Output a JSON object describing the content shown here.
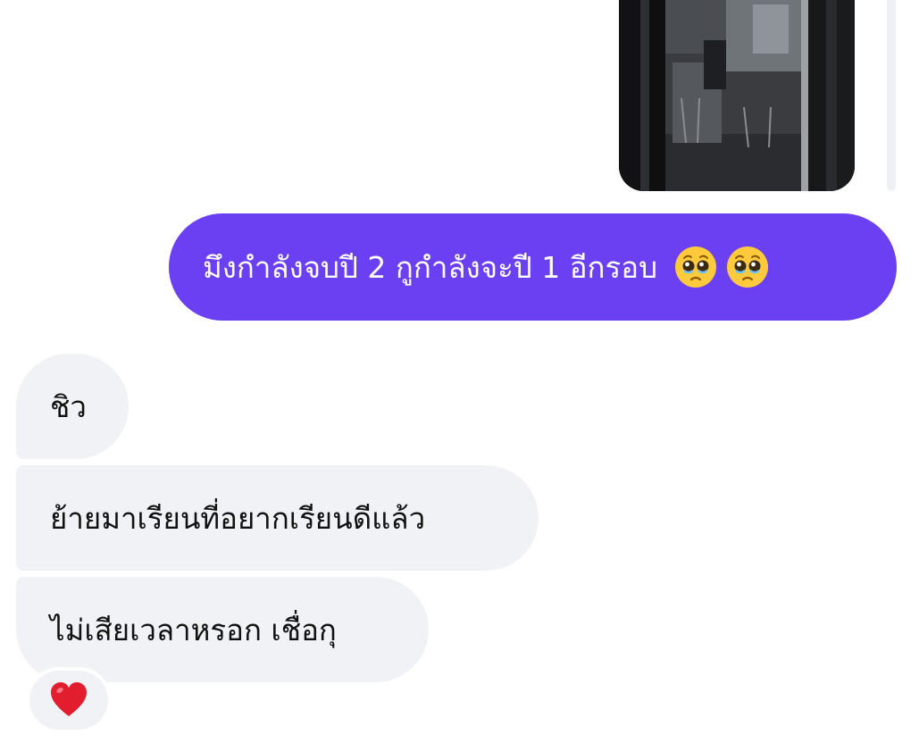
{
  "conversation": {
    "photo_message": {
      "media": "photo-of-glass-door"
    },
    "outgoing_message": {
      "text": "มึงกำลังจบปี 2 กูกำลังจะปี 1 อีกรอบ",
      "emojis": [
        "pleading-face",
        "pleading-face"
      ],
      "bubble_color": "#6b3ff2"
    },
    "incoming_messages": [
      "ชิว",
      "ย้ายมาเรียนที่อยากเรียนดีแล้ว",
      "ไม่เสียเวลาหรอก เชื่อกุ"
    ],
    "reaction": {
      "emoji": "red-heart",
      "color": "#e11d2e"
    },
    "incoming_bubble_color": "#f1f2f5"
  }
}
